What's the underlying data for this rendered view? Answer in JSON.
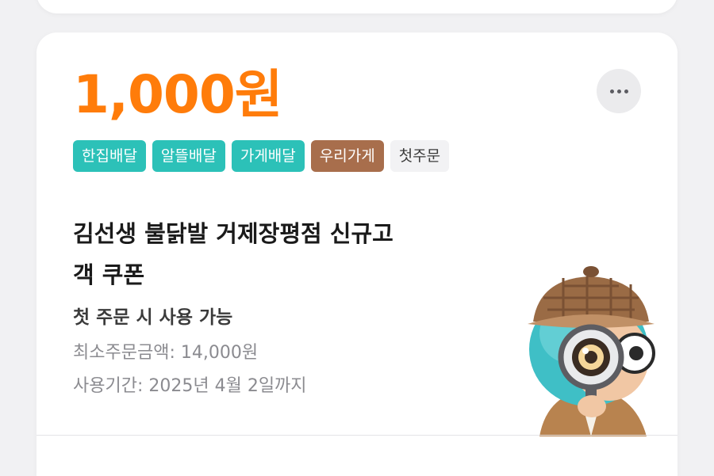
{
  "coupon": {
    "amount": "1,000원",
    "tags": [
      {
        "label": "한집배달",
        "color": "#2cc1b8"
      },
      {
        "label": "알뜰배달",
        "color": "#2cc1b8"
      },
      {
        "label": "가게배달",
        "color": "#2cc1b8"
      },
      {
        "label": "우리가게",
        "color": "#a86e4c"
      },
      {
        "label": "첫주문",
        "color": "#f2f2f4"
      }
    ],
    "store_name_line1": "김선생 불닭발 거제장평점 신규고",
    "store_name_line2": "객 쿠폰",
    "condition": "첫 주문 시 사용 가능",
    "min_order": "최소주문금액: 14,000원",
    "period": "사용기간: 2025년 4월 2일까지",
    "more_icon": "more-horizontal-icon",
    "accent_color": "#ff7c0a"
  }
}
